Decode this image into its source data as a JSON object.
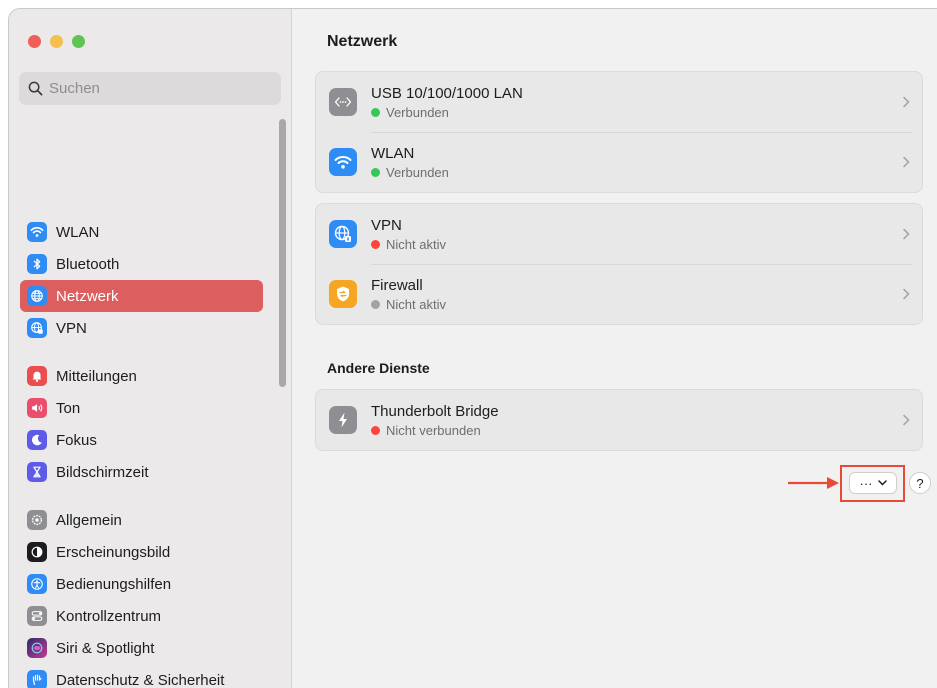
{
  "window": {
    "traffic_lights": [
      "close",
      "minimize",
      "zoom"
    ]
  },
  "sidebar": {
    "search_placeholder": "Suchen",
    "items": [
      {
        "label": "WLAN",
        "icon": "wifi-icon",
        "color": "#2f8cf5",
        "active": false
      },
      {
        "label": "Bluetooth",
        "icon": "bluetooth-icon",
        "color": "#2f8cf5",
        "active": false
      },
      {
        "label": "Netzwerk",
        "icon": "globe-icon",
        "color": "#2f8cf5",
        "active": true
      },
      {
        "label": "VPN",
        "icon": "vpn-globe-icon",
        "color": "#2f8cf5",
        "active": false
      },
      {
        "label": "Mitteilungen",
        "icon": "bell-icon",
        "color": "#eb4e4f",
        "active": false
      },
      {
        "label": "Ton",
        "icon": "speaker-icon",
        "color": "#eb4e6d",
        "active": false
      },
      {
        "label": "Fokus",
        "icon": "moon-icon",
        "color": "#5e5ce6",
        "active": false
      },
      {
        "label": "Bildschirmzeit",
        "icon": "hourglass-icon",
        "color": "#5e5ce6",
        "active": false
      },
      {
        "label": "Allgemein",
        "icon": "gear-icon",
        "color": "#8e8e93",
        "active": false
      },
      {
        "label": "Erscheinungsbild",
        "icon": "appearance-icon",
        "color": "#1d1d1f",
        "active": false
      },
      {
        "label": "Bedienungshilfen",
        "icon": "accessibility-icon",
        "color": "#2f8cf5",
        "active": false
      },
      {
        "label": "Kontrollzentrum",
        "icon": "toggles-icon",
        "color": "#8e8e93",
        "active": false
      },
      {
        "label": "Siri & Spotlight",
        "icon": "siri-icon",
        "color": "#6b4fc4",
        "active": false
      },
      {
        "label": "Datenschutz & Sicherheit",
        "icon": "hand-icon",
        "color": "#2f8cf5",
        "active": false
      }
    ]
  },
  "main": {
    "title": "Netzwerk",
    "services": [
      {
        "name": "USB 10/100/1000 LAN",
        "status": "Verbunden",
        "status_color": "#34c759",
        "icon": "ethernet-icon",
        "icon_color": "#8e8e93"
      },
      {
        "name": "WLAN",
        "status": "Verbunden",
        "status_color": "#34c759",
        "icon": "wifi-icon",
        "icon_color": "#2f8cf5"
      }
    ],
    "security": [
      {
        "name": "VPN",
        "status": "Nicht aktiv",
        "status_color": "#ff453a",
        "icon": "vpn-globe-icon",
        "icon_color": "#2f8cf5"
      },
      {
        "name": "Firewall",
        "status": "Nicht aktiv",
        "status_color": "#a1a1a6",
        "icon": "firewall-icon",
        "icon_color": "#f5a623"
      }
    ],
    "other_title": "Andere Dienste",
    "other": [
      {
        "name": "Thunderbolt Bridge",
        "status": "Nicht verbunden",
        "status_color": "#ff453a",
        "icon": "thunderbolt-icon",
        "icon_color": "#8e8e93"
      }
    ],
    "more_button_label": "···",
    "help_label": "?",
    "annotation_color": "#e54b36"
  }
}
